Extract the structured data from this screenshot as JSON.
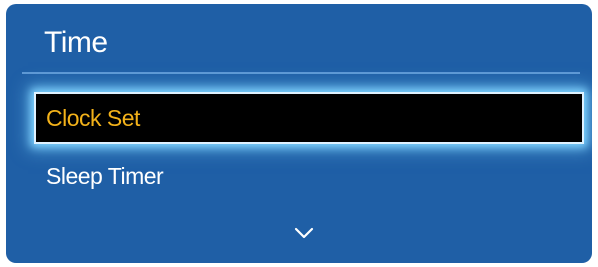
{
  "menu": {
    "title": "Time",
    "items": [
      {
        "label": "Clock Set",
        "selected": true
      },
      {
        "label": "Sleep Timer",
        "selected": false
      }
    ],
    "more_indicator_icon": "chevron-down-icon"
  },
  "colors": {
    "panel_bg": "#1f5fa6",
    "selected_text": "#f3b21a",
    "selected_bg": "#000000",
    "highlight_glow": "#7fd3ff",
    "text": "#ffffff"
  }
}
